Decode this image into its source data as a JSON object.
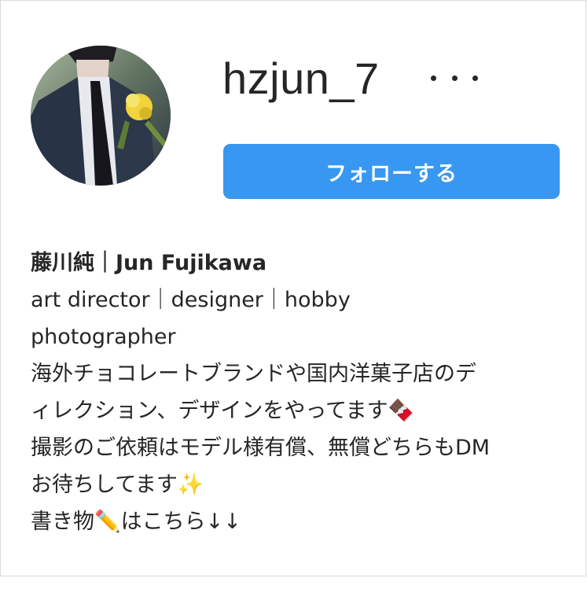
{
  "profile": {
    "username": "hzjun_7",
    "follow_label": "フォローする",
    "more_icon": "more-horizontal-icon",
    "avatar_icon": "profile-photo",
    "bio": {
      "name": "藤川純｜Jun Fujikawa",
      "lines": [
        "art director｜designer｜hobby",
        "photographer",
        "海外チョコレートブランドや国内洋菓子店のデ",
        "ィレクション、デザインをやってます🍫",
        "撮影のご依頼はモデル様有償、無償どちらもDM",
        "お待ちしてます✨",
        "書き物✏️はこちら↓↓"
      ]
    }
  },
  "colors": {
    "accent": "#3897f0",
    "text": "#262626",
    "border": "#dbdbdb"
  }
}
